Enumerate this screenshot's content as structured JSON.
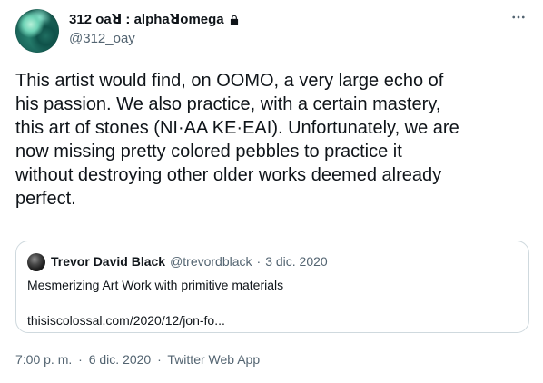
{
  "tweet": {
    "author": {
      "display_name": "312 oaꓤ : alphaꓤomega",
      "handle": "@312_oay",
      "verified_lock": true
    },
    "body_lines": [
      "This artist would find, on OOMO, a very large echo of",
      "his passion. We also practice, with a certain mastery,",
      "this art of stones (NI·AA KE·EAI). Unfortunately, we are",
      "now missing pretty colored pebbles to practice it",
      "without destroying other older works deemed already",
      "perfect."
    ],
    "quote": {
      "author": "Trevor David Black",
      "handle": "@trevordblack",
      "separator": "·",
      "date": "3 dic. 2020",
      "text": "Mesmerizing Art Work with primitive materials",
      "link": "thisiscolossal.com/2020/12/jon-fo..."
    },
    "meta": {
      "time": "7:00 p. m.",
      "separator": "·",
      "date": "6 dic. 2020",
      "separator2": "·",
      "source": "Twitter Web App"
    }
  },
  "icons": {
    "more": "ellipsis-icon",
    "lock": "lock-icon"
  }
}
